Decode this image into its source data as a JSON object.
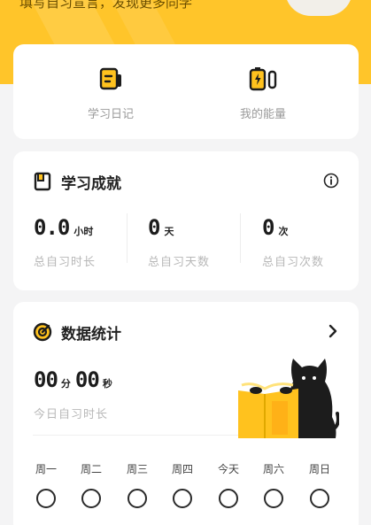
{
  "header": {
    "banner_text": "填写自习宣言，发现更多同学",
    "colors": {
      "brand": "#ffc52a",
      "icon_yellow": "#ffc21e",
      "dark": "#1c1c1c"
    }
  },
  "shortcuts": [
    {
      "label": "学习日记",
      "icon": "diary-icon"
    },
    {
      "label": "我的能量",
      "icon": "battery-icon"
    }
  ],
  "achievements": {
    "title": "学习成就",
    "icon": "notebook-icon",
    "info_icon": "info-icon",
    "metrics": [
      {
        "value": "0.0",
        "unit": "小时",
        "label": "总自习时长"
      },
      {
        "value": "0",
        "unit": "天",
        "label": "总自习天数"
      },
      {
        "value": "0",
        "unit": "次",
        "label": "总自习次数"
      }
    ]
  },
  "stats": {
    "title": "数据统计",
    "icon": "target-icon",
    "more_icon": "chevron-right-icon",
    "today": {
      "minutes": "00",
      "minutes_unit": "分",
      "seconds": "00",
      "seconds_unit": "秒",
      "label": "今日自习时长"
    },
    "illustration": "cat-reading-illustration",
    "week": [
      {
        "label": "周一"
      },
      {
        "label": "周二"
      },
      {
        "label": "周三"
      },
      {
        "label": "周四"
      },
      {
        "label": "今天"
      },
      {
        "label": "周六"
      },
      {
        "label": "周日"
      }
    ]
  }
}
